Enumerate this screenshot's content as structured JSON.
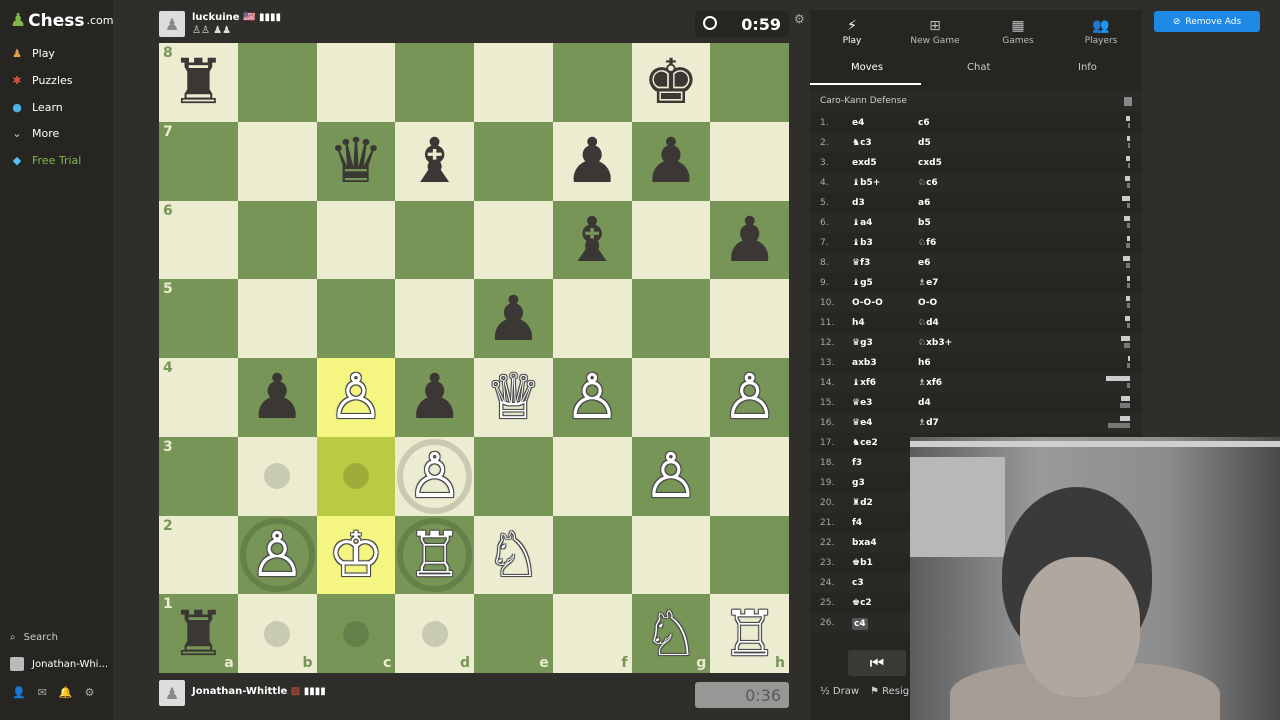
{
  "sidebar": {
    "logo_text": "Chess",
    "logo_suffix": ".com",
    "items": [
      {
        "label": "Play",
        "icon": "play-icon"
      },
      {
        "label": "Puzzles",
        "icon": "puzzle-icon"
      },
      {
        "label": "Learn",
        "icon": "learn-icon"
      },
      {
        "label": "More",
        "icon": "chevron-down-icon"
      },
      {
        "label": "Free Trial",
        "icon": "diamond-icon"
      }
    ],
    "search_label": "Search",
    "user_label": "Jonathan-Whi..."
  },
  "top_player": {
    "name": "luckuine",
    "flag": "🇺🇸",
    "clock": "0:59"
  },
  "bottom_player": {
    "name": "Jonathan-Whittle",
    "clock": "0:36"
  },
  "board": {
    "files": [
      "a",
      "b",
      "c",
      "d",
      "e",
      "f",
      "g",
      "h"
    ],
    "ranks": [
      "8",
      "7",
      "6",
      "5",
      "4",
      "3",
      "2",
      "1"
    ],
    "pieces": {
      "a8": "♜",
      "g8": "♚",
      "c7": "♛",
      "d7": "♝",
      "f7": "♟",
      "g7": "♟",
      "f6": "♝",
      "h6": "♟",
      "e5": "♟",
      "b4": "♟",
      "c4": "♙",
      "d4": "♟",
      "e4": "♕",
      "f4": "♙",
      "h4": "♙",
      "d3": "♙",
      "g3": "♙",
      "b2": "♙",
      "c2": "♔",
      "d2": "♖",
      "e2": "♘",
      "a1": "♜",
      "g1": "♘",
      "h1": "♖"
    },
    "highlight": [
      "c4",
      "c3",
      "c2"
    ],
    "dots": [
      "b3",
      "c3",
      "b1",
      "c1",
      "d1"
    ],
    "rings": [
      "d3",
      "b2",
      "d2"
    ]
  },
  "panel": {
    "tabs": [
      {
        "label": "Play",
        "icon": "lightning-icon"
      },
      {
        "label": "New Game",
        "icon": "plus-icon"
      },
      {
        "label": "Games",
        "icon": "board-icon"
      },
      {
        "label": "Players",
        "icon": "players-icon"
      }
    ],
    "subtabs": [
      "Moves",
      "Chat",
      "Info"
    ],
    "opening": "Caro-Kann Defense",
    "moves": [
      {
        "n": "1.",
        "w": "e4",
        "b": "c6",
        "tw": "2.5s",
        "tb": "0.4s"
      },
      {
        "n": "2.",
        "w": "♞c3",
        "b": "d5",
        "tw": "1.2s",
        "tb": "0.4s"
      },
      {
        "n": "3.",
        "w": "exd5",
        "b": "cxd5",
        "tw": "1.8s",
        "tb": "0.1s"
      },
      {
        "n": "4.",
        "w": "♝b5+",
        "b": "♘c6",
        "tw": "3.0s",
        "tb": "0.9s"
      },
      {
        "n": "5.",
        "w": "d3",
        "b": "a6",
        "tw": "5.7s",
        "tb": "0.7s"
      },
      {
        "n": "6.",
        "w": "♝a4",
        "b": "b5",
        "tw": "4.2s",
        "tb": "0.6s"
      },
      {
        "n": "7.",
        "w": "♝b3",
        "b": "♘f6",
        "tw": "0.6s",
        "tb": "2.1s"
      },
      {
        "n": "8.",
        "w": "♛f3",
        "b": "e6",
        "tw": "5.1s",
        "tb": "2.5s"
      },
      {
        "n": "9.",
        "w": "♝g5",
        "b": "♗e7",
        "tw": "1.5s",
        "tb": "1.0s"
      },
      {
        "n": "10.",
        "w": "O-O-O",
        "b": "O-O",
        "tw": "2.0s",
        "tb": "1.0s"
      },
      {
        "n": "11.",
        "w": "h4",
        "b": "♘d4",
        "tw": "2.6s",
        "tb": "1.1s"
      },
      {
        "n": "12.",
        "w": "♛g3",
        "b": "♘xb3+",
        "tw": "6.6s",
        "tb": "4.3s"
      },
      {
        "n": "13.",
        "w": "axb3",
        "b": "h6",
        "tw": "0.1s",
        "tb": "1.4s"
      },
      {
        "n": "14.",
        "w": "♝xf6",
        "b": "♗xf6",
        "tw": "22.1s",
        "tb": "1.3s"
      },
      {
        "n": "15.",
        "w": "♛e3",
        "b": "d4",
        "tw": "6.8s",
        "tb": "7.9s"
      },
      {
        "n": "16.",
        "w": "♛e4",
        "b": "♗d7",
        "tw": "8.1s",
        "tb": "20.0s"
      },
      {
        "n": "17.",
        "w": "♞ce2",
        "b": "",
        "tw": "",
        "tb": ""
      },
      {
        "n": "18.",
        "w": "f3",
        "b": "",
        "tw": "",
        "tb": ""
      },
      {
        "n": "19.",
        "w": "g3",
        "b": "",
        "tw": "",
        "tb": ""
      },
      {
        "n": "20.",
        "w": "♜d2",
        "b": "",
        "tw": "",
        "tb": ""
      },
      {
        "n": "21.",
        "w": "f4",
        "b": "",
        "tw": "",
        "tb": ""
      },
      {
        "n": "22.",
        "w": "bxa4",
        "b": "",
        "tw": "",
        "tb": ""
      },
      {
        "n": "23.",
        "w": "♚b1",
        "b": "",
        "tw": "",
        "tb": ""
      },
      {
        "n": "24.",
        "w": "c3",
        "b": "",
        "tw": "",
        "tb": ""
      },
      {
        "n": "25.",
        "w": "♚c2",
        "b": "",
        "tw": "",
        "tb": ""
      },
      {
        "n": "26.",
        "w": "c4",
        "b": "",
        "tw": "",
        "tb": ""
      }
    ],
    "draw_label": "Draw",
    "resign_label": "Resign"
  },
  "remove_ads_label": "Remove Ads"
}
